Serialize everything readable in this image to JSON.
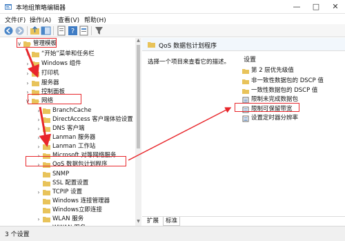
{
  "window": {
    "title": "本地组策略编辑器",
    "minimize_icon": "minimize-icon",
    "maximize_icon": "maximize-icon",
    "close_icon": "close-icon"
  },
  "menu": [
    "文件(F)",
    "操作(A)",
    "查看(V)",
    "帮助(H)"
  ],
  "toolbar": [
    "back-icon",
    "forward-icon",
    "up-folder-icon",
    "show-tree-icon",
    "export-icon",
    "help-icon",
    "properties-icon",
    "filter-icon"
  ],
  "tree": [
    {
      "label": "管理模板",
      "expanded": true
    },
    {
      "label": "“开始”菜单和任务栏",
      "expanded": false
    },
    {
      "label": "Windows 组件",
      "expanded": false
    },
    {
      "label": "打印机",
      "expanded": false
    },
    {
      "label": "服务器",
      "expanded": false
    },
    {
      "label": "控制面板",
      "expanded": false
    },
    {
      "label": "网络",
      "expanded": true
    },
    {
      "label": "BranchCache",
      "expanded": false
    },
    {
      "label": "DirectAccess 客户端体验设置",
      "expanded": false
    },
    {
      "label": "DNS 客户端",
      "expanded": false
    },
    {
      "label": "Lanman 服务器",
      "expanded": false
    },
    {
      "label": "Lanman 工作站",
      "expanded": false
    },
    {
      "label": "Microsoft 对等网络服务",
      "expanded": false
    },
    {
      "label": "QoS 数据包计划程序",
      "expanded": false
    },
    {
      "label": "SNMP",
      "expanded": false
    },
    {
      "label": "SSL 配置设置",
      "expanded": false
    },
    {
      "label": "TCPIP 设置",
      "expanded": false
    },
    {
      "label": "Windows 连接管理器",
      "expanded": false
    },
    {
      "label": "Windows立即连接",
      "expanded": false
    },
    {
      "label": "WLAN 服务",
      "expanded": false
    },
    {
      "label": "WWAN 服务",
      "expanded": false
    }
  ],
  "right": {
    "header": "QoS 数据包计划程序",
    "description": "选择一个项目来查看它的描述。",
    "list_header": "设置",
    "items": [
      {
        "label": "第 2 层优先级值",
        "type": "folder"
      },
      {
        "label": "非一致性数据包的 DSCP 值",
        "type": "folder"
      },
      {
        "label": "一致性数据包的 DSCP 值",
        "type": "folder"
      },
      {
        "label": "限制未完成数据包",
        "type": "setting"
      },
      {
        "label": "限制可保留带宽",
        "type": "setting"
      },
      {
        "label": "设置定时器分辨率",
        "type": "setting"
      }
    ],
    "tabs": [
      "扩展",
      "标准"
    ]
  },
  "status": "3 个设置",
  "colors": {
    "highlight": "#e8262b",
    "folder": "#e8c35a",
    "header_bg": "#f2f7fc"
  }
}
